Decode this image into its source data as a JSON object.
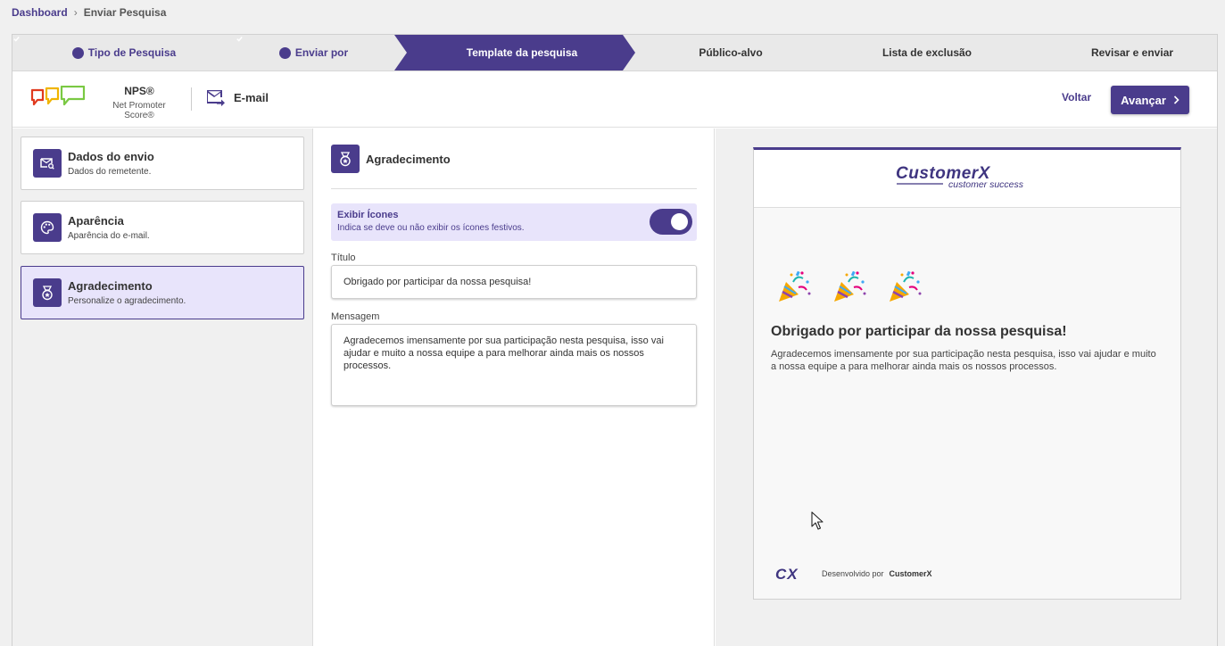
{
  "breadcrumb": {
    "home": "Dashboard",
    "separator": "›",
    "current": "Enviar Pesquisa"
  },
  "steps": [
    {
      "label": "Tipo de Pesquisa",
      "state": "done"
    },
    {
      "label": "Enviar por",
      "state": "done"
    },
    {
      "label": "Template da pesquisa",
      "state": "active"
    },
    {
      "label": "Público-alvo",
      "state": "pending"
    },
    {
      "label": "Lista de exclusão",
      "state": "pending"
    },
    {
      "label": "Revisar e enviar",
      "state": "pending"
    }
  ],
  "survey": {
    "title": "NPS®",
    "subtitle": "Net Promoter Score®",
    "channel": "E-mail"
  },
  "actions": {
    "back": "Voltar",
    "next": "Avançar",
    "next_icon": "chevron-right-icon"
  },
  "sidebar": {
    "items": [
      {
        "title": "Dados do envio",
        "subtitle": "Dados do remetente.",
        "icon": "envelope-search-icon"
      },
      {
        "title": "Aparência",
        "subtitle": "Aparência do e-mail.",
        "icon": "palette-icon"
      },
      {
        "title": "Agradecimento",
        "subtitle": "Personalize o agradecimento.",
        "icon": "medal-icon",
        "selected": true
      }
    ]
  },
  "editor": {
    "section_title": "Agradecimento",
    "toggle": {
      "label": "Exibir Ícones",
      "description": "Indica se deve ou não exibir os ícones festivos.",
      "on": true
    },
    "title_label": "Título",
    "title_value": "Obrigado por participar da nossa pesquisa!",
    "message_label": "Mensagem",
    "message_value": "Agradecemos imensamente por sua participação nesta pesquisa, isso vai ajudar e muito a nossa equipe a para melhorar ainda mais os nossos processos."
  },
  "preview": {
    "brand": "CustomerX",
    "brand_tagline": "customer success",
    "title": "Obrigado por participar da nossa pesquisa!",
    "message": "Agradecemos imensamente por sua participação nesta pesquisa, isso vai ajudar e muito a nossa equipe a para melhorar ainda mais os nossos processos.",
    "footer_text": "Desenvolvido por",
    "footer_brand": "CustomerX",
    "footer_logo": "CX"
  },
  "colors": {
    "primary": "#4a3c8c",
    "selected_bg": "#e8e4fb"
  }
}
